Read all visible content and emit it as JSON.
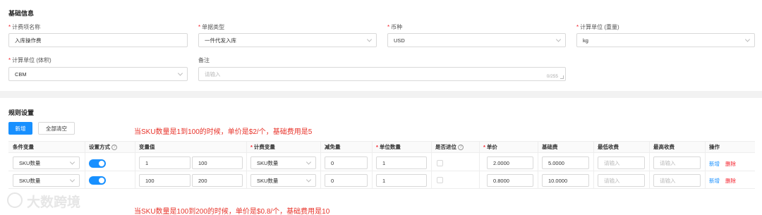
{
  "basic": {
    "title": "基础信息",
    "fee_name": {
      "label": "计费项名称",
      "value": "入库操作费"
    },
    "doc_type": {
      "label": "单据类型",
      "value": "一件代发入库"
    },
    "currency": {
      "label": "币种",
      "value": "USD"
    },
    "unit_weight": {
      "label": "计算单位 (重量)",
      "value": "kg"
    },
    "unit_volume": {
      "label": "计算单位 (体积)",
      "value": "CBM"
    },
    "remark": {
      "label": "备注",
      "placeholder": "请输入",
      "counter": "0/255"
    }
  },
  "rules": {
    "title": "规则设置",
    "add_label": "新增",
    "clear_label": "全部清空",
    "note1": "当SKU数量是1到100的时候，单价是$2/个，基础费用是5",
    "note2": "当SKU数量是100到200的时候，单价是$0.8/个，基础费用是10",
    "headers": {
      "cond": "条件变量",
      "mode": "设置方式",
      "var": "变量值",
      "calc": "计费变量",
      "minus": "减免量",
      "unitqty": "单位数量",
      "carry": "是否进位",
      "price": "单价",
      "base": "基础费",
      "min": "最低收费",
      "max": "最高收费",
      "ops": "操作"
    },
    "placeholder": "请输入",
    "rows": [
      {
        "cond": "SKU数量",
        "from": "1",
        "to": "100",
        "calc": "SKU数量",
        "minus": "0",
        "unitqty": "1",
        "price": "2.0000",
        "base": "5.0000",
        "add": "新增",
        "del": "删除"
      },
      {
        "cond": "SKU数量",
        "from": "100",
        "to": "200",
        "calc": "SKU数量",
        "minus": "0",
        "unitqty": "1",
        "price": "0.8000",
        "base": "10.0000",
        "add": "新增",
        "del": "删除"
      }
    ]
  },
  "watermark": "大数跨境",
  "colors": {
    "primary": "#1890ff",
    "required": "#f5222d",
    "note": "#e8332a"
  }
}
